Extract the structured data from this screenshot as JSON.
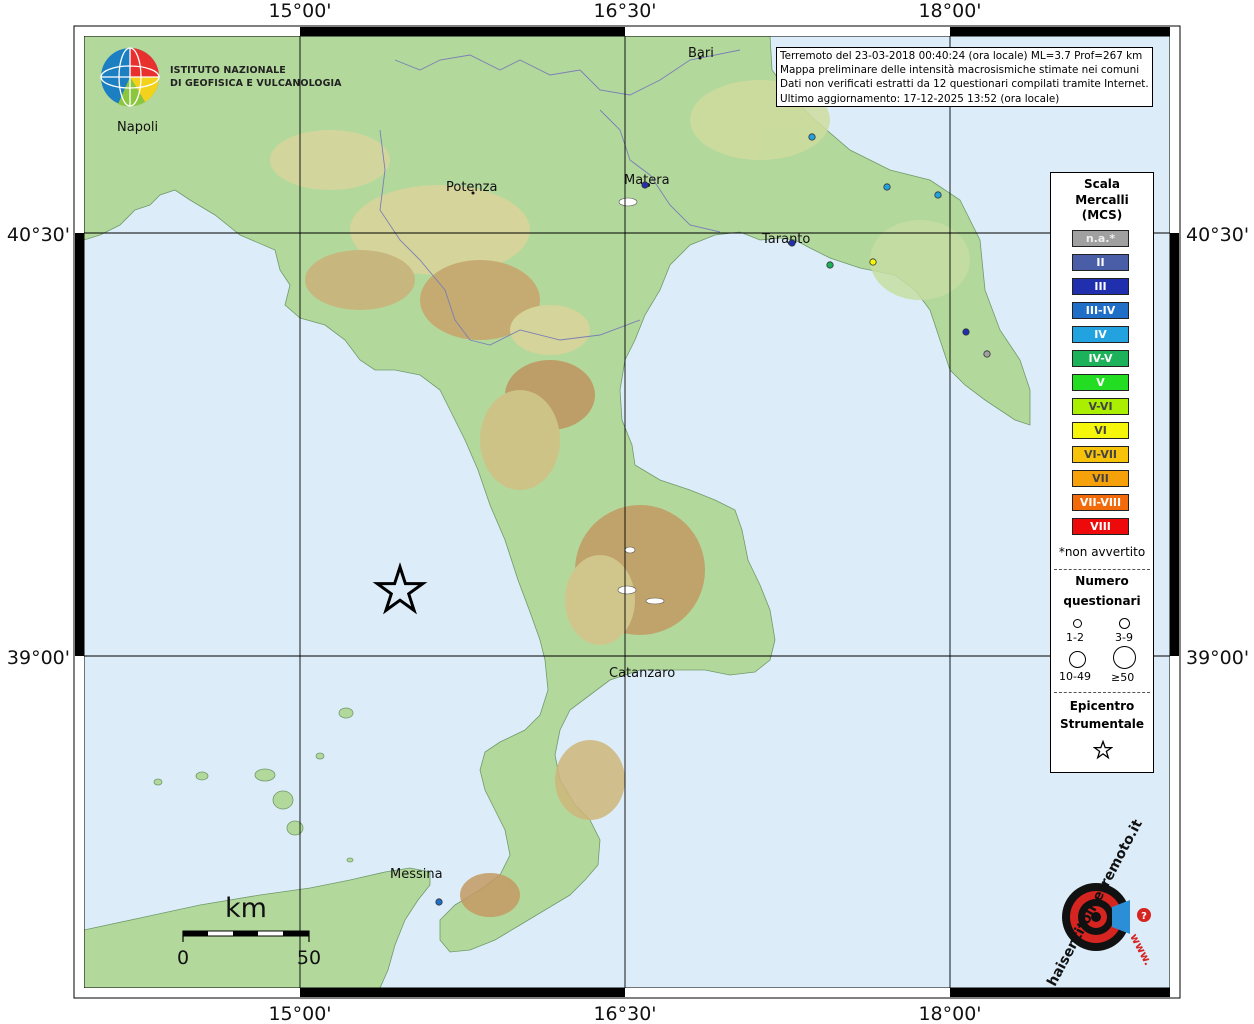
{
  "info_box": {
    "line1": "Terremoto del 23-03-2018 00:40:24 (ora locale) ML=3.7 Prof=267 km",
    "line2": "Mappa preliminare delle intensità macrosismiche stimate nei comuni",
    "line3": "Dati non verificati estratti da 12 questionari compilati tramite Internet.",
    "line4": "Ultimo aggiornamento: 17-12-2025 13:52 (ora locale)"
  },
  "axes": {
    "lon_top": [
      "15°00'",
      "16°30'",
      "18°00'"
    ],
    "lon_bottom": [
      "15°00'",
      "16°30'",
      "18°00'"
    ],
    "lat_left": [
      "40°30'",
      "39°00'"
    ],
    "lat_right": [
      "40°30'",
      "39°00'"
    ]
  },
  "cities": {
    "napoli": "Napoli",
    "potenza": "Potenza",
    "matera": "Matera",
    "bari": "Bari",
    "taranto": "Taranto",
    "catanzaro": "Catanzaro",
    "messina": "Messina"
  },
  "logo_ingv": {
    "line1": "ISTITUTO NAZIONALE",
    "line2": "DI GEOFISICA E VULCANOLOGIA"
  },
  "logo_hst": {
    "text": "haisentitoilterremoto.it",
    "www": "www."
  },
  "scale_bar": {
    "unit": "km",
    "min": "0",
    "max": "50"
  },
  "legend": {
    "title1": "Scala",
    "title2": "Mercalli",
    "title3": "(MCS)",
    "classes": [
      {
        "label": "n.a.*",
        "color": "#a0a0a0"
      },
      {
        "label": "II",
        "color": "#4a5ea8"
      },
      {
        "label": "III",
        "color": "#1f2fae"
      },
      {
        "label": "III-IV",
        "color": "#1f6fc8"
      },
      {
        "label": "IV",
        "color": "#22a3e0"
      },
      {
        "label": "IV-V",
        "color": "#1bb25a"
      },
      {
        "label": "V",
        "color": "#22dd22"
      },
      {
        "label": "V-VI",
        "color": "#aaee00"
      },
      {
        "label": "VI",
        "color": "#f6f60a"
      },
      {
        "label": "VI-VII",
        "color": "#f6c20a"
      },
      {
        "label": "VII",
        "color": "#f6a00a"
      },
      {
        "label": "VII-VIII",
        "color": "#f26a0a"
      },
      {
        "label": "VIII",
        "color": "#ee0a0a"
      }
    ],
    "note": "*non avvertito",
    "count_title1": "Numero",
    "count_title2": "questionari",
    "count_labels": [
      "1-2",
      "3-9",
      "10-49",
      "≥50"
    ],
    "epi_title1": "Epicentro",
    "epi_title2": "Strumentale"
  },
  "observations": [
    {
      "mcs": "IV",
      "color": "#22a3e0"
    },
    {
      "mcs": "IV",
      "color": "#22a3e0"
    },
    {
      "mcs": "IV",
      "color": "#22a3e0"
    },
    {
      "mcs": "III",
      "color": "#1f2fae"
    },
    {
      "mcs": "IV-V",
      "color": "#1bb25a"
    },
    {
      "mcs": "VI",
      "color": "#f6f60a"
    },
    {
      "mcs": "III",
      "color": "#1f2fae"
    },
    {
      "mcs": "n.a.*",
      "color": "#a0a0a0"
    },
    {
      "mcs": "III",
      "color": "#1f2fae"
    },
    {
      "mcs": "III-IV",
      "color": "#1f6fc8"
    }
  ],
  "colors": {
    "sea": "#dcedf9",
    "land_low": "#a7d49a",
    "land_mid": "#cfd99a",
    "land_high": "#c9a46a",
    "land_peak": "#b07d4a"
  }
}
